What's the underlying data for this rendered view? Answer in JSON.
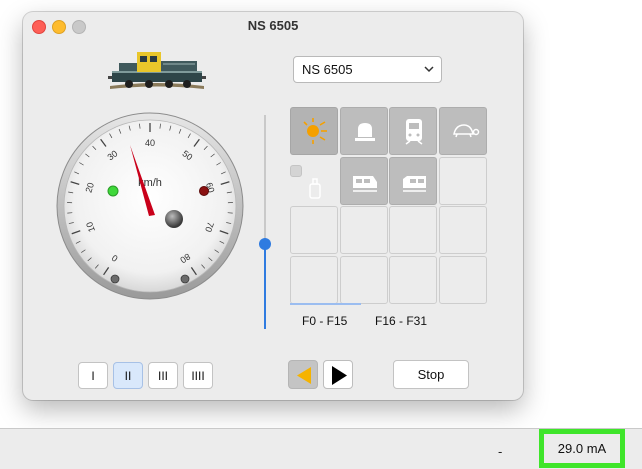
{
  "window": {
    "title": "NS 6505"
  },
  "locomotive": {
    "selected": "NS 6505",
    "icon": "locomotive-image"
  },
  "speedometer": {
    "unit": "km/h",
    "ticks": [
      "0",
      "10",
      "20",
      "30",
      "40",
      "50",
      "60",
      "70",
      "80"
    ]
  },
  "function_tabs": [
    {
      "label": "F0 - F15",
      "selected": true
    },
    {
      "label": "F16 - F31",
      "selected": false
    }
  ],
  "function_buttons": [
    {
      "icon": "headlight-icon",
      "active": true
    },
    {
      "icon": "beacon-icon",
      "active": false
    },
    {
      "icon": "train-front-icon",
      "active": false
    },
    {
      "icon": "turtle-icon",
      "active": false
    },
    {
      "icon": "coupler-icon",
      "active": false
    },
    {
      "icon": "cab-light-icon",
      "active": false
    },
    {
      "icon": "horn-icon",
      "active": false
    },
    {
      "icon": "",
      "active": false
    }
  ],
  "speed_steps": [
    {
      "label": "I",
      "selected": false
    },
    {
      "label": "II",
      "selected": true
    },
    {
      "label": "III",
      "selected": false
    },
    {
      "label": "IIII",
      "selected": false
    }
  ],
  "direction": {
    "reverse_icon": "triangle-left-icon",
    "forward_icon": "triangle-right-icon",
    "current": "reverse"
  },
  "stop_label": "Stop",
  "status_bar": {
    "dash": "-",
    "current": "29.0 mA"
  },
  "colors": {
    "highlight": "#3fe52a",
    "accent": "#2f7be0",
    "needle": "#c9001a",
    "headlight": "#f5a000"
  }
}
